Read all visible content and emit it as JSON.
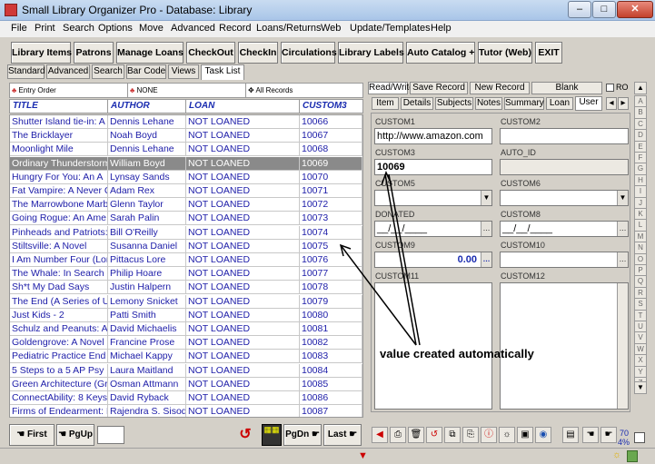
{
  "window": {
    "title": "Small Library Organizer Pro - Database: Library",
    "minimize": "–",
    "maximize": "□",
    "close": "✕"
  },
  "menu": [
    "File",
    "Print",
    "Search",
    "Options",
    "Move",
    "Advanced",
    "Record",
    "Loans/Returns",
    "Web",
    "Update/Templates",
    "Help"
  ],
  "toolbar": [
    "Library Items",
    "Patrons",
    "Manage Loans",
    "CheckOut",
    "CheckIn",
    "Circulations",
    "Library Labels",
    "Auto Catalog +",
    "Tutor (Web)",
    "EXIT"
  ],
  "subtabs": [
    "Standard",
    "Advanced",
    "Search",
    "Bar Code",
    "Views",
    "Task List"
  ],
  "sortbar": {
    "entry_order": "Entry Order",
    "none": "NONE",
    "all_records": "All Records"
  },
  "grid": {
    "columns": [
      "TITLE",
      "AUTHOR",
      "LOAN",
      "CUSTOM3"
    ],
    "rows": [
      [
        "Shutter Island tie-in: A",
        "Dennis Lehane",
        "NOT LOANED",
        "10066"
      ],
      [
        "The Bricklayer",
        "Noah Boyd",
        "NOT LOANED",
        "10067"
      ],
      [
        "Moonlight Mile",
        "Dennis Lehane",
        "NOT LOANED",
        "10068"
      ],
      [
        "Ordinary Thunderstorm",
        "William Boyd",
        "NOT LOANED",
        "10069"
      ],
      [
        "Hungry For You: An A",
        "Lynsay Sands",
        "NOT LOANED",
        "10070"
      ],
      [
        "Fat Vampire: A Never C",
        "Adam Rex",
        "NOT LOANED",
        "10071"
      ],
      [
        "The Marrowbone Marbl",
        "Glenn Taylor",
        "NOT LOANED",
        "10072"
      ],
      [
        "Going Rogue: An Ame",
        "Sarah Palin",
        "NOT LOANED",
        "10073"
      ],
      [
        "Pinheads and Patriots:",
        "Bill O'Reilly",
        "NOT LOANED",
        "10074"
      ],
      [
        "Stiltsville: A Novel",
        "Susanna Daniel",
        "NOT LOANED",
        "10075"
      ],
      [
        "I Am Number Four (Lor",
        "Pittacus Lore",
        "NOT LOANED",
        "10076"
      ],
      [
        "The Whale: In Search o",
        "Philip Hoare",
        "NOT LOANED",
        "10077"
      ],
      [
        "Sh*t My Dad Says",
        "Justin Halpern",
        "NOT LOANED",
        "10078"
      ],
      [
        "The End (A Series of U",
        "Lemony Snicket",
        "NOT LOANED",
        "10079"
      ],
      [
        "Just Kids - 2",
        "Patti Smith",
        "NOT LOANED",
        "10080"
      ],
      [
        "Schulz and Peanuts: A",
        "David Michaelis",
        "NOT LOANED",
        "10081"
      ],
      [
        "Goldengrove: A Novel",
        "Francine Prose",
        "NOT LOANED",
        "10082"
      ],
      [
        "Pediatric Practice End",
        "Michael Kappy",
        "NOT LOANED",
        "10083"
      ],
      [
        "5 Steps to a 5 AP Psy",
        "Laura Maitland",
        "NOT LOANED",
        "10084"
      ],
      [
        "Green Architecture (Gr",
        "Osman Attmann",
        "NOT LOANED",
        "10085"
      ],
      [
        "ConnectAbility: 8 Keys",
        "David Ryback",
        "NOT LOANED",
        "10086"
      ],
      [
        "Firms of Endearment: I",
        "Rajendra S. Sisod",
        "NOT LOANED",
        "10087"
      ]
    ],
    "selected_index": 3
  },
  "nav": {
    "first": "First",
    "pgup": "PgUp",
    "pgdn": "PgDn",
    "last": "Last"
  },
  "record_bar": {
    "readwrite": "Read/Write",
    "save": "Save Record",
    "new": "New Record",
    "blank": "Blank",
    "ro": "RO"
  },
  "record_tabs": [
    "Item",
    "Details",
    "Subjects",
    "Notes",
    "Summary",
    "Loan",
    "User"
  ],
  "form": {
    "custom1_label": "CUSTOM1",
    "custom1_value": "http://www.amazon.com",
    "custom2_label": "CUSTOM2",
    "custom2_value": "",
    "custom3_label": "CUSTOM3",
    "custom3_value": "10069",
    "autoid_label": "AUTO_ID",
    "autoid_value": "",
    "custom5_label": "CUSTOM5",
    "custom6_label": "CUSTOM6",
    "donated_label": "DONATED",
    "donated_value": "__/__/____",
    "custom8_label": "CUSTOM8",
    "custom8_value": "__/__/____",
    "custom9_label": "CUSTOM9",
    "custom9_value": "0.00",
    "custom10_label": "CUSTOM10",
    "custom11_label": "CUSTOM11",
    "custom12_label": "CUSTOM12"
  },
  "alpha": [
    "A",
    "B",
    "C",
    "D",
    "E",
    "F",
    "G",
    "H",
    "I",
    "J",
    "K",
    "L",
    "M",
    "N",
    "O",
    "P",
    "Q",
    "R",
    "S",
    "T",
    "U",
    "V",
    "W",
    "X",
    "Y",
    "Z"
  ],
  "annotation": "value created automatically",
  "status": {
    "count": "70",
    "percent": "4%"
  }
}
